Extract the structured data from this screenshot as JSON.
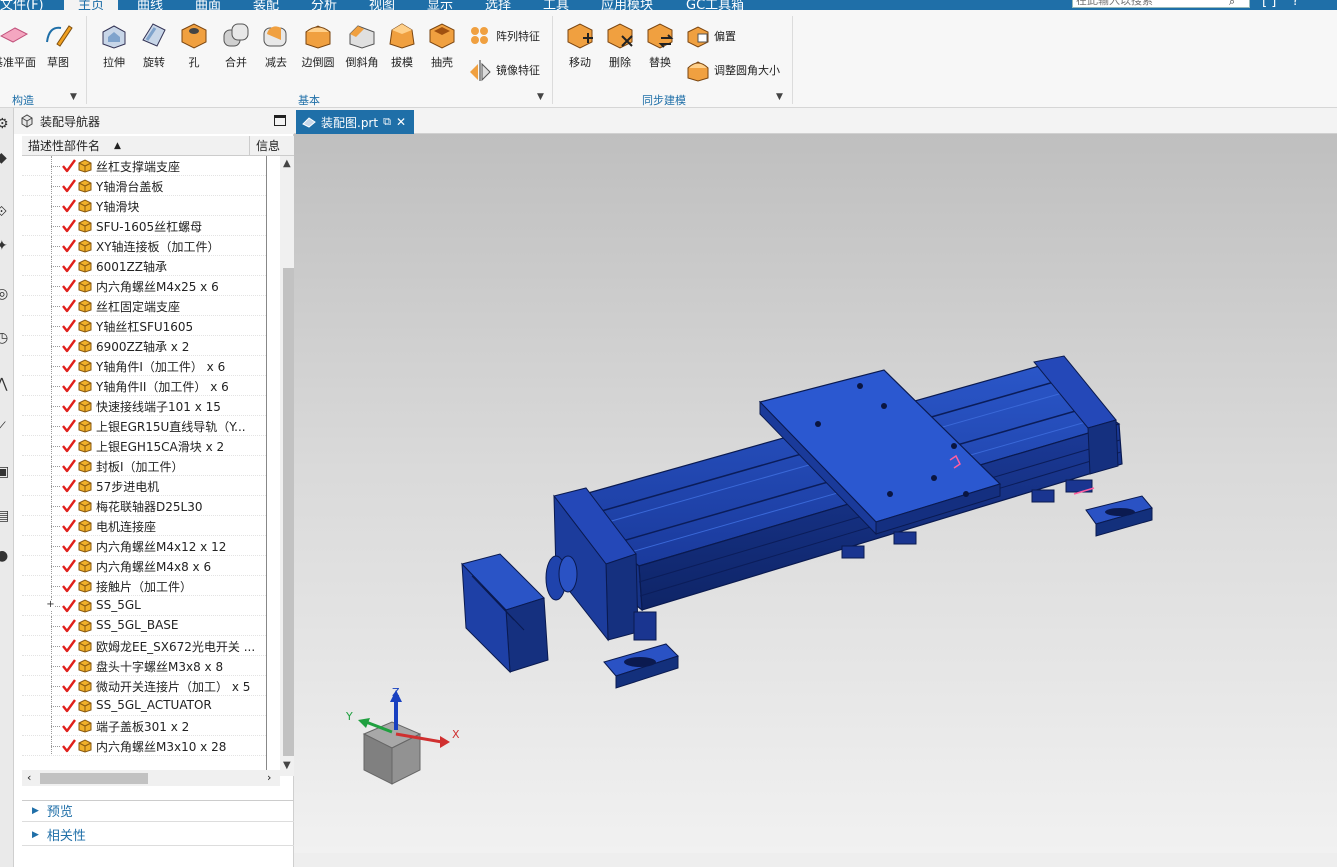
{
  "menubar": {
    "items": [
      "文件(F)",
      "主页",
      "曲线",
      "曲面",
      "装配",
      "分析",
      "视图",
      "显示",
      "选择",
      "工具",
      "应用模块",
      "GC工具箱"
    ],
    "search_placeholder": "在此输入以搜索"
  },
  "ribbon": {
    "groups": {
      "construct": {
        "label": "构造",
        "buttons": [
          "基准平面",
          "草图"
        ]
      },
      "basic": {
        "label": "基本",
        "buttons": [
          "拉伸",
          "旋转",
          "孔",
          "合并",
          "减去",
          "边倒圆",
          "倒斜角",
          "拔模",
          "抽壳"
        ],
        "small_buttons": [
          "阵列特征",
          "镜像特征"
        ]
      },
      "sync": {
        "label": "同步建模",
        "buttons": [
          "移动",
          "删除",
          "替换"
        ],
        "small_buttons": [
          "偏置",
          "调整圆角大小"
        ]
      }
    }
  },
  "navigator": {
    "title": "装配导航器",
    "col_name": "描述性部件名",
    "col_info": "信息",
    "parts": [
      "丝杠支撑端支座",
      "Y轴滑台盖板",
      "Y轴滑块",
      "SFU-1605丝杠螺母",
      "XY轴连接板（加工件）",
      "6001ZZ轴承",
      "内六角螺丝M4x25 x 6",
      "丝杠固定端支座",
      "Y轴丝杠SFU1605",
      "6900ZZ轴承 x 2",
      "Y轴角件I（加工件） x 6",
      "Y轴角件II（加工件） x 6",
      "快速接线端子101 x 15",
      "上银EGR15U直线导轨（Y...",
      "上银EGH15CA滑块 x 2",
      "封板I（加工件）",
      "57步进电机",
      "梅花联轴器D25L30",
      "电机连接座",
      "内六角螺丝M4x12 x 12",
      "内六角螺丝M4x8 x 6",
      "接触片（加工件）",
      "SS_5GL",
      "SS_5GL_BASE",
      "欧姆龙EE_SX672光电开关 ...",
      "盘头十字螺丝M3x8 x 8",
      "微动开关连接片（加工） x 5",
      "SS_5GL_ACTUATOR",
      "端子盖板301 x 2",
      "内六角螺丝M3x10 x 28"
    ],
    "expandable_index": 22,
    "sections": [
      "预览",
      "相关性"
    ]
  },
  "tab": {
    "label": "装配图.prt"
  },
  "triad": {
    "x": "X",
    "y": "Y",
    "z": "Z"
  },
  "colors": {
    "accent": "#1f6fa8",
    "part_blue": "#1f3fa0",
    "check_red": "#e0201c",
    "part_box": "#f0b02a"
  }
}
